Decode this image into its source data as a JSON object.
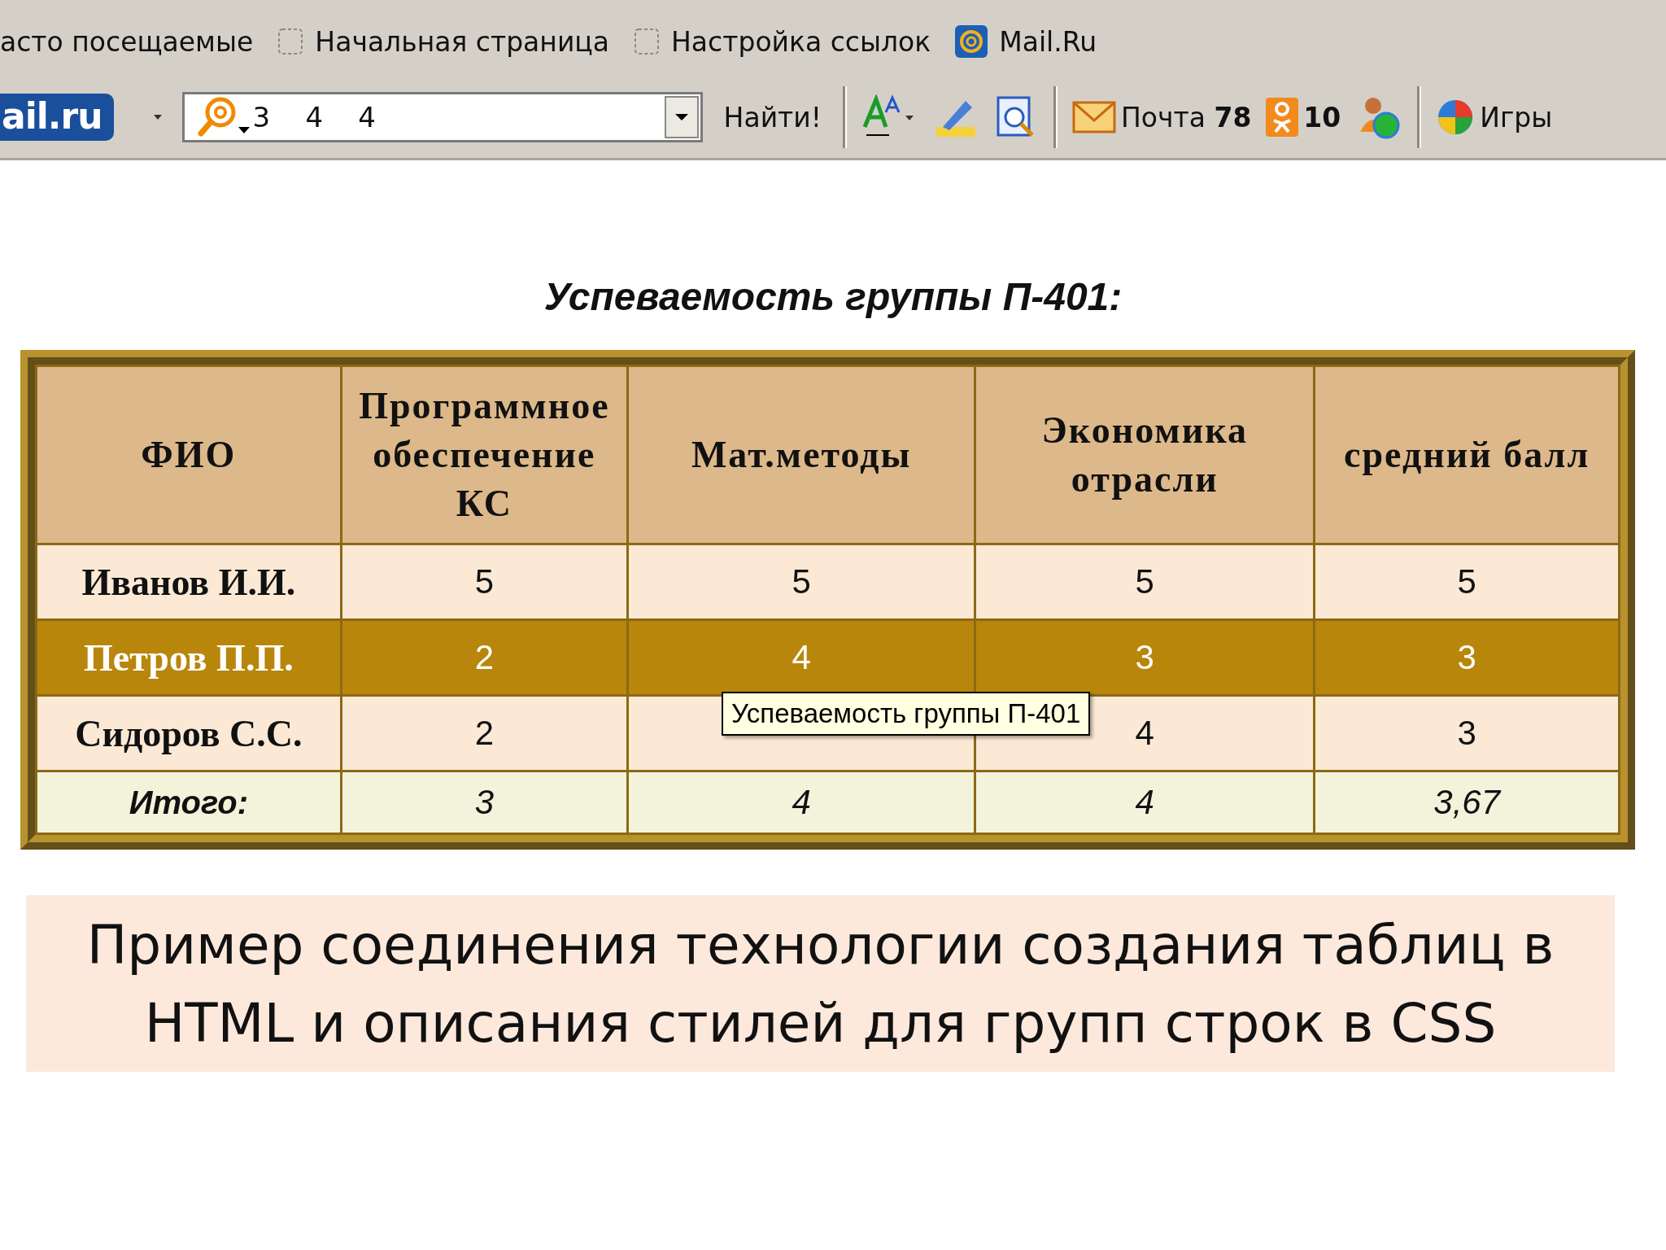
{
  "bookmarks": [
    {
      "kind": "plain",
      "label": "асто посещаемые"
    },
    {
      "kind": "page",
      "label": "Начальная страница"
    },
    {
      "kind": "page",
      "label": "Настройка ссылок"
    },
    {
      "kind": "mail",
      "label": "Mail.Ru"
    }
  ],
  "toolbar": {
    "logo": "ail.ru",
    "search_value": "3    4    4",
    "search_button": "Найти!",
    "mail_label": "Почта",
    "mail_count": "78",
    "ok_count": "10",
    "games": "Игры"
  },
  "title": "Успеваемость группы П-401:",
  "table": {
    "columns": [
      "ФИО",
      "Программное обеспечение КС",
      "Мат.методы",
      "Экономика отрасли",
      "средний балл"
    ],
    "rows": [
      {
        "kind": "data",
        "highlighted": false,
        "cells": [
          "Иванов И.И.",
          "5",
          "5",
          "5",
          "5"
        ]
      },
      {
        "kind": "data",
        "highlighted": true,
        "cells": [
          "Петров П.П.",
          "2",
          "4",
          "3",
          "3"
        ]
      },
      {
        "kind": "data",
        "highlighted": false,
        "cells": [
          "Сидоров С.С.",
          "2",
          null,
          "4",
          "3"
        ]
      },
      {
        "kind": "total",
        "cells": [
          "Итого:",
          "3",
          "4",
          "4",
          "3,67"
        ]
      }
    ]
  },
  "tooltip": "Успеваемость группы П-401",
  "caption": [
    "Пример соединения технологии создания таблиц в",
    "HTML  и описания стилей для групп строк в CSS"
  ]
}
